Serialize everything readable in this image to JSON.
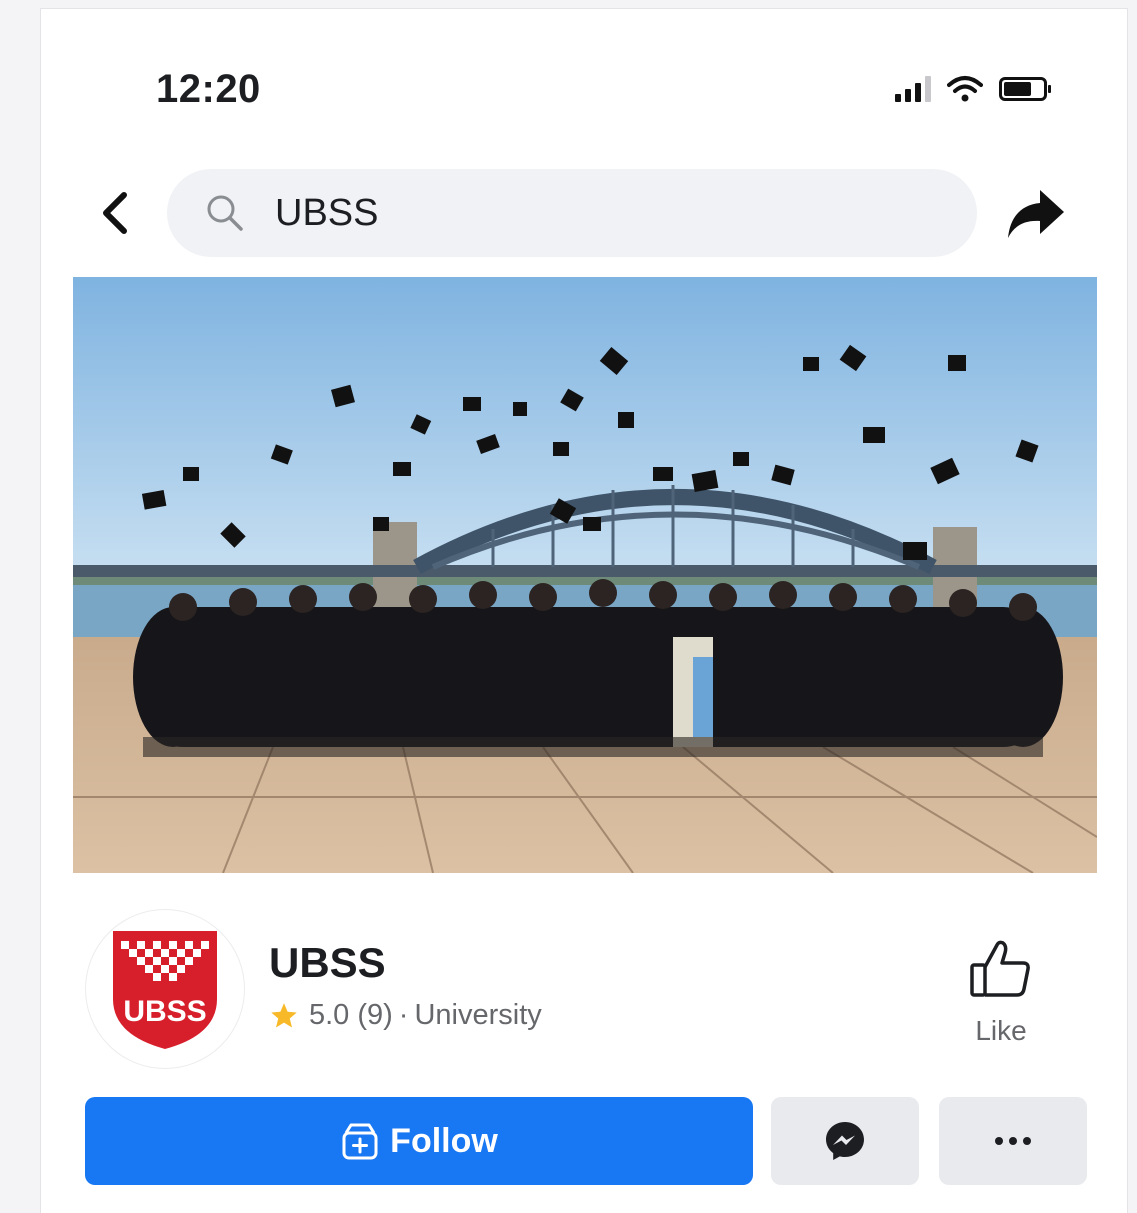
{
  "status_bar": {
    "time": "12:20"
  },
  "header": {
    "search_query": "UBSS"
  },
  "page": {
    "name": "UBSS",
    "logo_text": "UBSS",
    "rating": "5.0",
    "reviews": "(9)",
    "separator": "·",
    "category": "University",
    "like_label": "Like"
  },
  "actions": {
    "follow_label": "Follow"
  },
  "icons": [
    "back-icon",
    "search-icon",
    "share-icon",
    "star-icon",
    "thumbs-up-icon",
    "follow-icon",
    "messenger-icon",
    "more-icon"
  ],
  "colors": {
    "accent": "#1877f2",
    "logo_red": "#d71f2b",
    "star": "#f7b928",
    "muted": "#65676b"
  }
}
